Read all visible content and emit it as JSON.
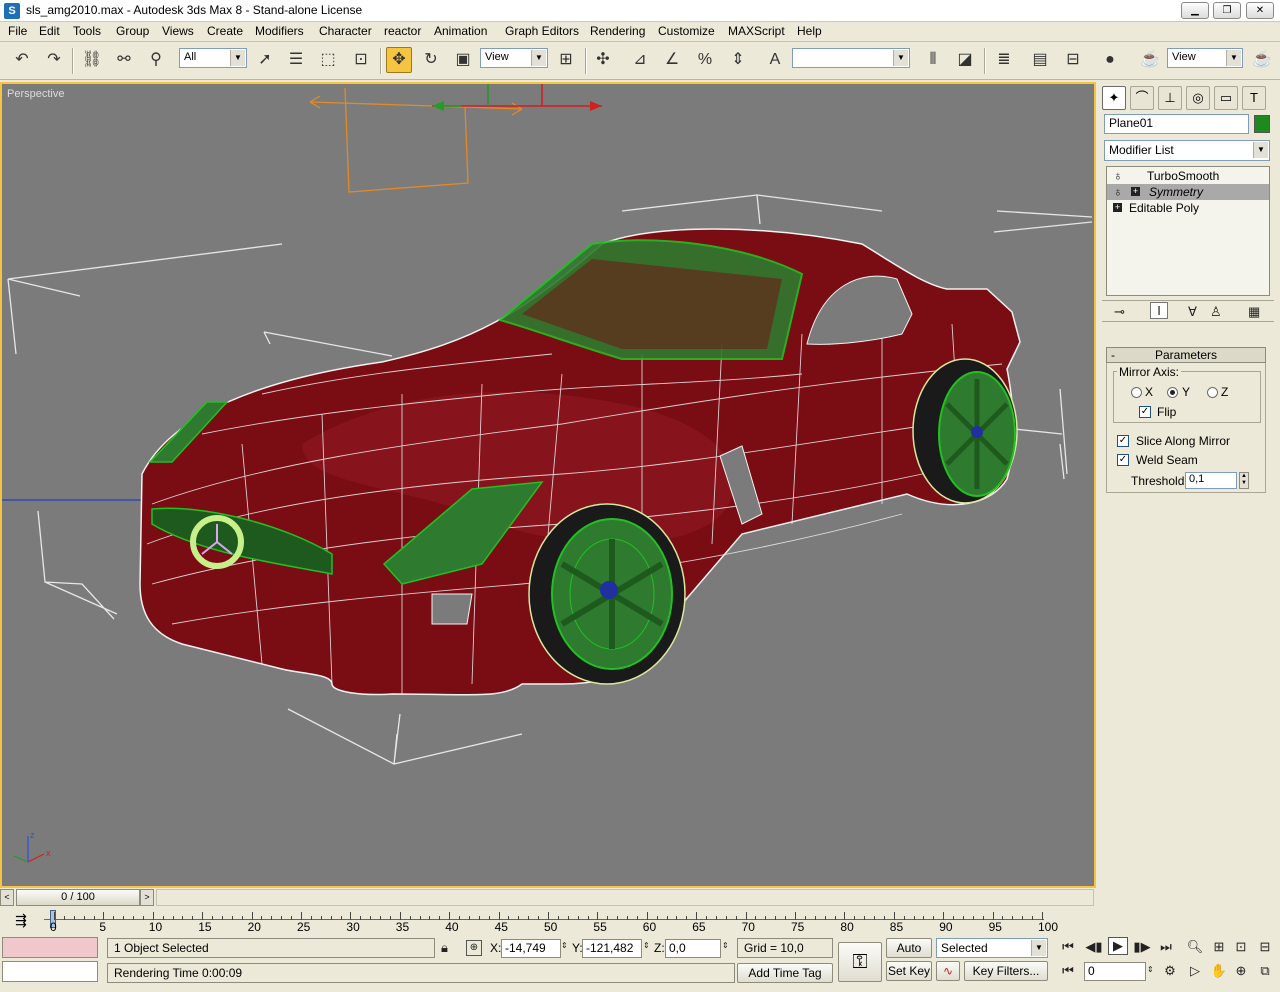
{
  "window": {
    "title": "sls_amg2010.max - Autodesk 3ds Max 8  - Stand-alone License",
    "app_icon": "S"
  },
  "menu": [
    "File",
    "Edit",
    "Tools",
    "Group",
    "Views",
    "Create",
    "Modifiers",
    "Character",
    "reactor",
    "Animation",
    "Graph Editors",
    "Rendering",
    "Customize",
    "MAXScript",
    "Help"
  ],
  "toolbar": {
    "selection_filter": "All",
    "ref_coord": "View",
    "named_selection": "",
    "render_view": "View"
  },
  "viewport": {
    "label": "Perspective"
  },
  "command_panel": {
    "object_name": "Plane01",
    "object_color": "#1E8A1E",
    "modifier_list": "Modifier List",
    "stack": [
      "TurboSmooth",
      "Symmetry",
      "Editable Poly"
    ],
    "rollout_title": "Parameters",
    "rollout_toggle": "-",
    "mirror_axis_label": "Mirror Axis:",
    "axes": [
      "X",
      "Y",
      "Z"
    ],
    "selected_axis": "Y",
    "flip": {
      "label": "Flip",
      "checked": true
    },
    "slice": {
      "label": "Slice Along Mirror",
      "checked": true
    },
    "weld": {
      "label": "Weld Seam",
      "checked": true
    },
    "threshold": {
      "label": "Threshold:",
      "value": "0,1"
    }
  },
  "timeline": {
    "frame": "0 / 100",
    "ticks": [
      "0",
      "5",
      "10",
      "15",
      "20",
      "25",
      "30",
      "35",
      "40",
      "45",
      "50",
      "55",
      "60",
      "65",
      "70",
      "75",
      "80",
      "85",
      "90",
      "95",
      "100"
    ]
  },
  "status": {
    "selection": "1 Object Selected",
    "prompt": "Rendering Time  0:00:09",
    "x": "-14,749",
    "y": "-121,482",
    "z": "0,0",
    "grid": "Grid = 10,0",
    "add_time_tag": "Add Time Tag",
    "auto_key": "Auto Key",
    "set_key": "Set Key",
    "key_mode": "Selected",
    "key_filters": "Key Filters...",
    "current_frame": "0",
    "axis_labels": [
      "X:",
      "Y:",
      "Z:"
    ]
  }
}
